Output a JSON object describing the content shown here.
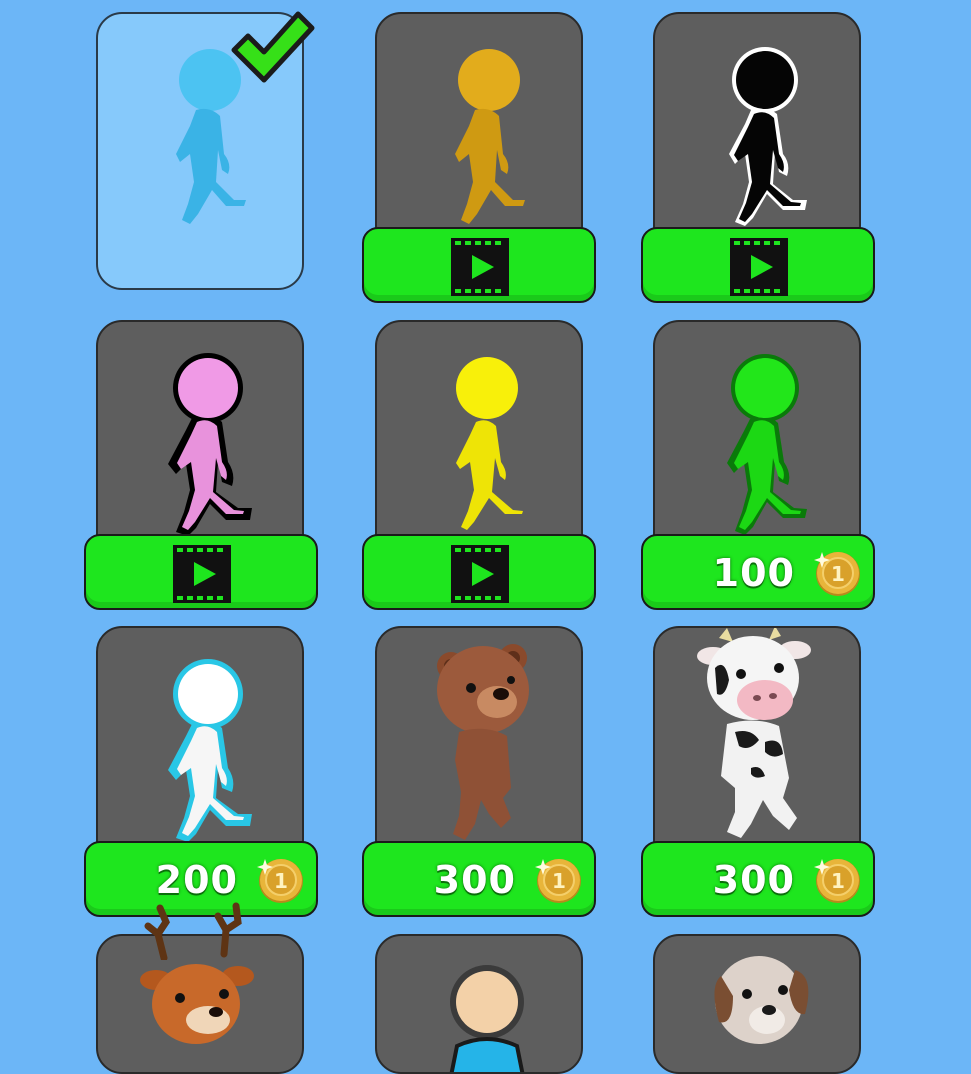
{
  "shop": {
    "skins": [
      {
        "name": "Blue",
        "color": "#4cc3f2",
        "outline": "none",
        "selected": true,
        "unlock": "selected"
      },
      {
        "name": "Gold",
        "color": "#e2ac1c",
        "outline": "none",
        "selected": false,
        "unlock": "video"
      },
      {
        "name": "Black",
        "color": "#050505",
        "outline": "#ffffff",
        "selected": false,
        "unlock": "video"
      },
      {
        "name": "Pink",
        "color": "#f09ae6",
        "outline": "#000000",
        "selected": false,
        "unlock": "video"
      },
      {
        "name": "Yellow",
        "color": "#f8f00a",
        "outline": "none",
        "selected": false,
        "unlock": "video"
      },
      {
        "name": "Green",
        "color": "#22e61a",
        "outline": "#0a7a0a",
        "selected": false,
        "unlock": "coins",
        "price": "100"
      },
      {
        "name": "White",
        "color": "#ffffff",
        "outline": "#29c7e6",
        "selected": false,
        "unlock": "coins",
        "price": "200"
      },
      {
        "name": "Bear",
        "color": "#9c5a3c",
        "outline": "none",
        "selected": false,
        "unlock": "coins",
        "price": "300"
      },
      {
        "name": "Cow",
        "color": "#f5f5f5",
        "outline": "none",
        "selected": false,
        "unlock": "coins",
        "price": "300"
      },
      {
        "name": "Deer",
        "color": "#c8692a",
        "outline": "none",
        "selected": false,
        "unlock": "hidden"
      },
      {
        "name": "Human",
        "color": "#f3d1a8",
        "outline": "none",
        "selected": false,
        "unlock": "hidden"
      },
      {
        "name": "Dog",
        "color": "#ddd2ca",
        "outline": "none",
        "selected": false,
        "unlock": "hidden"
      }
    ],
    "coin_label": "1"
  },
  "colors": {
    "background": "#6cb6f7",
    "card": "#5e5e5e",
    "selected_card": "#86c9fb",
    "button": "#1ee61e",
    "check": "#36e018",
    "coin": "#e8b53a"
  }
}
